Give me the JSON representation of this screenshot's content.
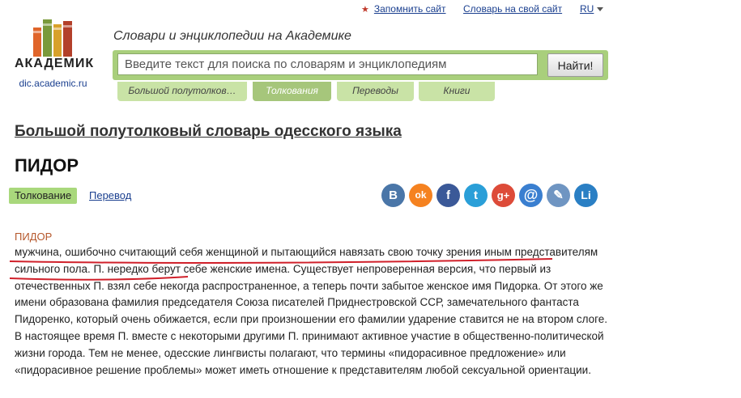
{
  "topbar": {
    "remember": "Запомнить сайт",
    "own_site": "Словарь на свой сайт",
    "language": "RU"
  },
  "logo": {
    "title": "АКАДЕМИК",
    "subtitle": "dic.academic.ru"
  },
  "tagline": "Словари и энциклопедии на Академике",
  "search": {
    "placeholder": "Введите текст для поиска по словарям и энциклопедиям",
    "button": "Найти!"
  },
  "tabs": [
    {
      "label": "Большой полутолков…"
    },
    {
      "label": "Толкования"
    },
    {
      "label": "Переводы"
    },
    {
      "label": "Книги"
    }
  ],
  "dictionary_title": "Большой полутолковый словарь одесского языка",
  "headword": "ПИДОР",
  "view_tabs": {
    "interpretation": "Толкование",
    "translation": "Перевод"
  },
  "share_icons": [
    {
      "name": "vk-icon",
      "glyph": "В",
      "color": "#4a76a8"
    },
    {
      "name": "odnoklassniki-icon",
      "glyph": "ok",
      "color": "#f58220"
    },
    {
      "name": "facebook-icon",
      "glyph": "f",
      "color": "#3b5998"
    },
    {
      "name": "twitter-icon",
      "glyph": "t",
      "color": "#2a9fd8"
    },
    {
      "name": "google-plus-icon",
      "glyph": "g+",
      "color": "#dd4b39"
    },
    {
      "name": "email-icon",
      "glyph": "@",
      "color": "#3a7fd0"
    },
    {
      "name": "livejournal-icon",
      "glyph": "✎",
      "color": "#6f95c2"
    },
    {
      "name": "liveinternet-icon",
      "glyph": "Li",
      "color": "#2a7fc4"
    }
  ],
  "entry": {
    "head": "ПИДОР",
    "body": "мужчина, ошибочно считающий себя женщиной и пытающийся навязать свою точку зрения иным представителям сильного пола. П. нередко берут себе женские имена. Существует непроверенная версия, что первый из отечественных П. взял себе некогда распространенное, а теперь почти забытое женское имя Пидорка. От этого же имени образована фамилия председателя Союза писателей Приднестровской ССР, замечательного фантаста Пидоренко, который очень обижается, если при произношении его фамилии ударение ставится не на втором слоге. В настоящее время П. вместе с некоторыми другими П. принимают активное участие в общественно-политической жизни города. Тем не менее, одесские лингвисты полагают, что термины «пидорасивное предложение» или «пидорасивное решение проблемы» может иметь отношение к представителям любой сексуальной ориентации."
  },
  "colors": {
    "accent_green": "#a9cf7c",
    "link_blue": "#1a3f8f",
    "headword_orange": "#b5572b",
    "annotation_red": "#d0202a"
  }
}
